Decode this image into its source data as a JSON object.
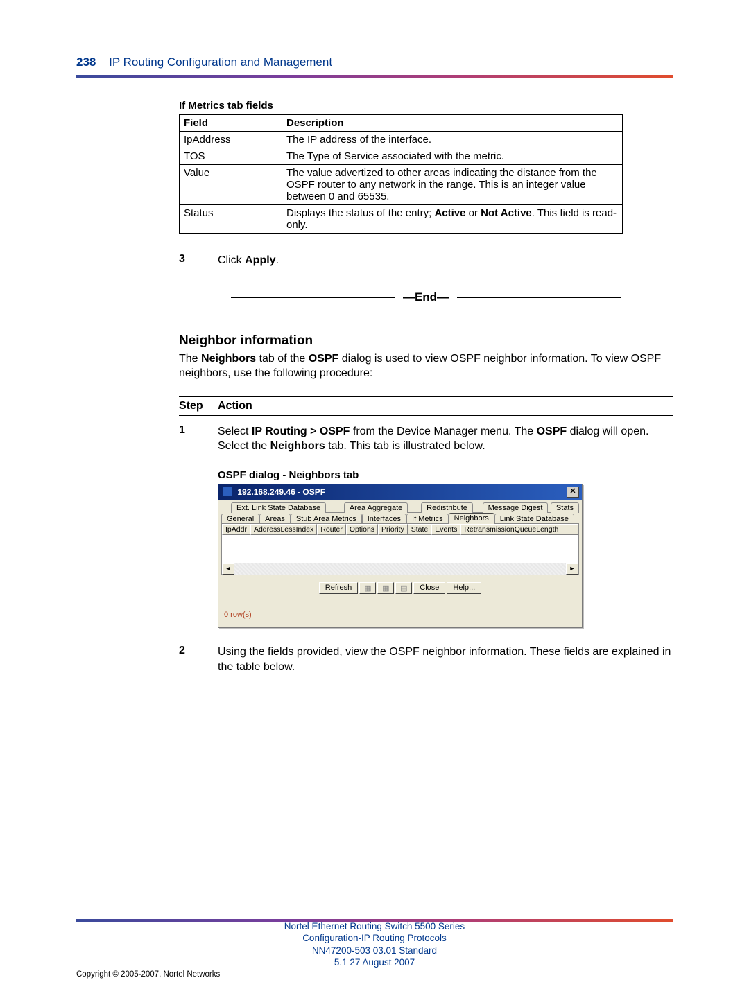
{
  "header": {
    "page_number": "238",
    "chapter": "IP Routing Configuration and Management"
  },
  "table": {
    "title": "If Metrics tab fields",
    "head_field": "Field",
    "head_desc": "Description",
    "rows": [
      {
        "field": "IpAddress",
        "desc": "The IP address of the interface."
      },
      {
        "field": "TOS",
        "desc": "The Type of Service associated with the metric."
      },
      {
        "field": "Value",
        "desc": "The value advertized to other areas indicating the distance from the OSPF router to any network in the range. This is an integer value between 0 and 65535."
      },
      {
        "field": "Status",
        "desc_pre": "Displays the status of the entry; ",
        "desc_b1": "Active",
        "desc_mid": " or ",
        "desc_b2": "Not Active",
        "desc_post": ". This field is read-only."
      }
    ]
  },
  "step3": {
    "num": "3",
    "pre": "Click ",
    "bold": "Apply",
    "post": "."
  },
  "end_label": "—End—",
  "section": {
    "title": "Neighbor information",
    "line1_pre": "The ",
    "line1_b1": "Neighbors",
    "line1_mid": " tab of the ",
    "line1_b2": "OSPF",
    "line1_post": " dialog is used to view OSPF neighbor information. To view OSPF neighbors, use the following procedure:"
  },
  "steps_header": {
    "step": "Step",
    "action": "Action"
  },
  "step1": {
    "num": "1",
    "pre": "Select ",
    "b1": "IP Routing > OSPF",
    "mid1": " from the Device Manager menu. The ",
    "b2": "OSPF",
    "mid2": " dialog will open. Select the ",
    "b3": "Neighbors",
    "post": " tab. This tab is illustrated below."
  },
  "dialog": {
    "caption": "OSPF dialog - Neighbors tab",
    "title": "192.168.249.46 - OSPF",
    "close": "✕",
    "tabs_row1": [
      "Ext. Link State Database",
      "Area Aggregate",
      "Redistribute",
      "Message Digest",
      "Stats"
    ],
    "tabs_row2": [
      "General",
      "Areas",
      "Stub Area Metrics",
      "Interfaces",
      "If Metrics",
      "Neighbors",
      "Link State Database"
    ],
    "active_tab": "Neighbors",
    "columns": [
      "IpAddr",
      "AddressLessIndex",
      "Router",
      "Options",
      "Priority",
      "State",
      "Events",
      "RetransmissionQueueLength"
    ],
    "scroll_left": "◄",
    "scroll_right": "►",
    "buttons": {
      "refresh": "Refresh",
      "close": "Close",
      "help": "Help..."
    },
    "icon_buttons": [
      "▦",
      "▦",
      "▤"
    ],
    "row_count": "0 row(s)"
  },
  "step2": {
    "num": "2",
    "text": "Using the fields provided, view the OSPF neighbor information. These fields are explained in the table below."
  },
  "footer": {
    "l1": "Nortel Ethernet Routing Switch 5500 Series",
    "l2": "Configuration-IP Routing Protocols",
    "l3": "NN47200-503   03.01   Standard",
    "l4": "5.1   27 August 2007",
    "copyright": "Copyright © 2005-2007, Nortel Networks"
  }
}
